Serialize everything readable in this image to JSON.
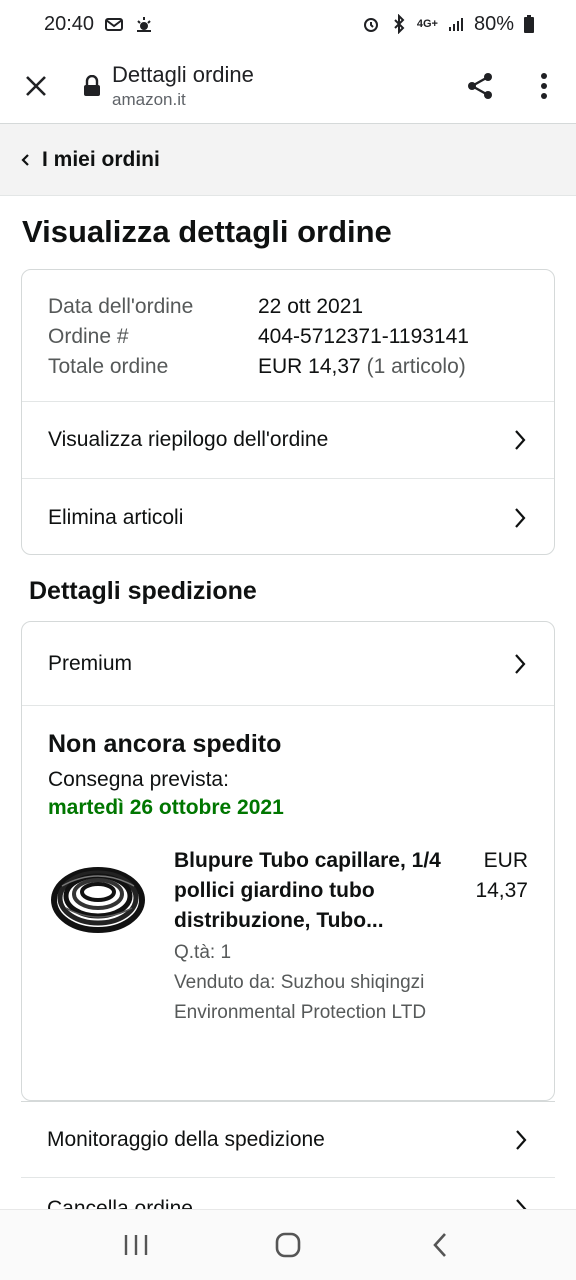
{
  "status_bar": {
    "time": "20:40",
    "battery": "80%",
    "network": "4G+"
  },
  "browser": {
    "page_title": "Dettagli ordine",
    "domain": "amazon.it"
  },
  "breadcrumb": {
    "label": "I miei ordini"
  },
  "page": {
    "title": "Visualizza dettagli ordine"
  },
  "order": {
    "date_label": "Data dell'ordine",
    "date_value": "22 ott 2021",
    "number_label": "Ordine #",
    "number_value": "404-5712371-1193141",
    "total_label": "Totale ordine",
    "total_value": "EUR 14,37",
    "total_count": "(1 articolo)",
    "summary_link": "Visualizza riepilogo dell'ordine",
    "remove_link": "Elimina articoli"
  },
  "shipping": {
    "section_title": "Dettagli spedizione",
    "service": "Premium",
    "status": "Non ancora spedito",
    "delivery_label": "Consegna prevista:",
    "delivery_date": "martedì 26 ottobre 2021",
    "item": {
      "title": "Blupure Tubo capillare, 1/4 pollici giardino tubo distribuzione, Tubo...",
      "qty": "Q.tà: 1",
      "seller": "Venduto da: Suzhou shiqingzi Environmental Protection LTD",
      "price_currency": "EUR",
      "price_value": "14,37"
    },
    "tracking_link": "Monitoraggio della spedizione",
    "next_link": "Cancella ordine"
  },
  "icons": {
    "close": "close-icon",
    "lock": "lock-icon",
    "share": "share-icon",
    "menu": "more-vert-icon",
    "chevron": "chevron-right-icon",
    "back_chevron": "chevron-left-icon"
  },
  "colors": {
    "delivery_green": "#007600",
    "breadcrumb_bg": "#f3f3f3",
    "border": "#d5d9d9"
  }
}
